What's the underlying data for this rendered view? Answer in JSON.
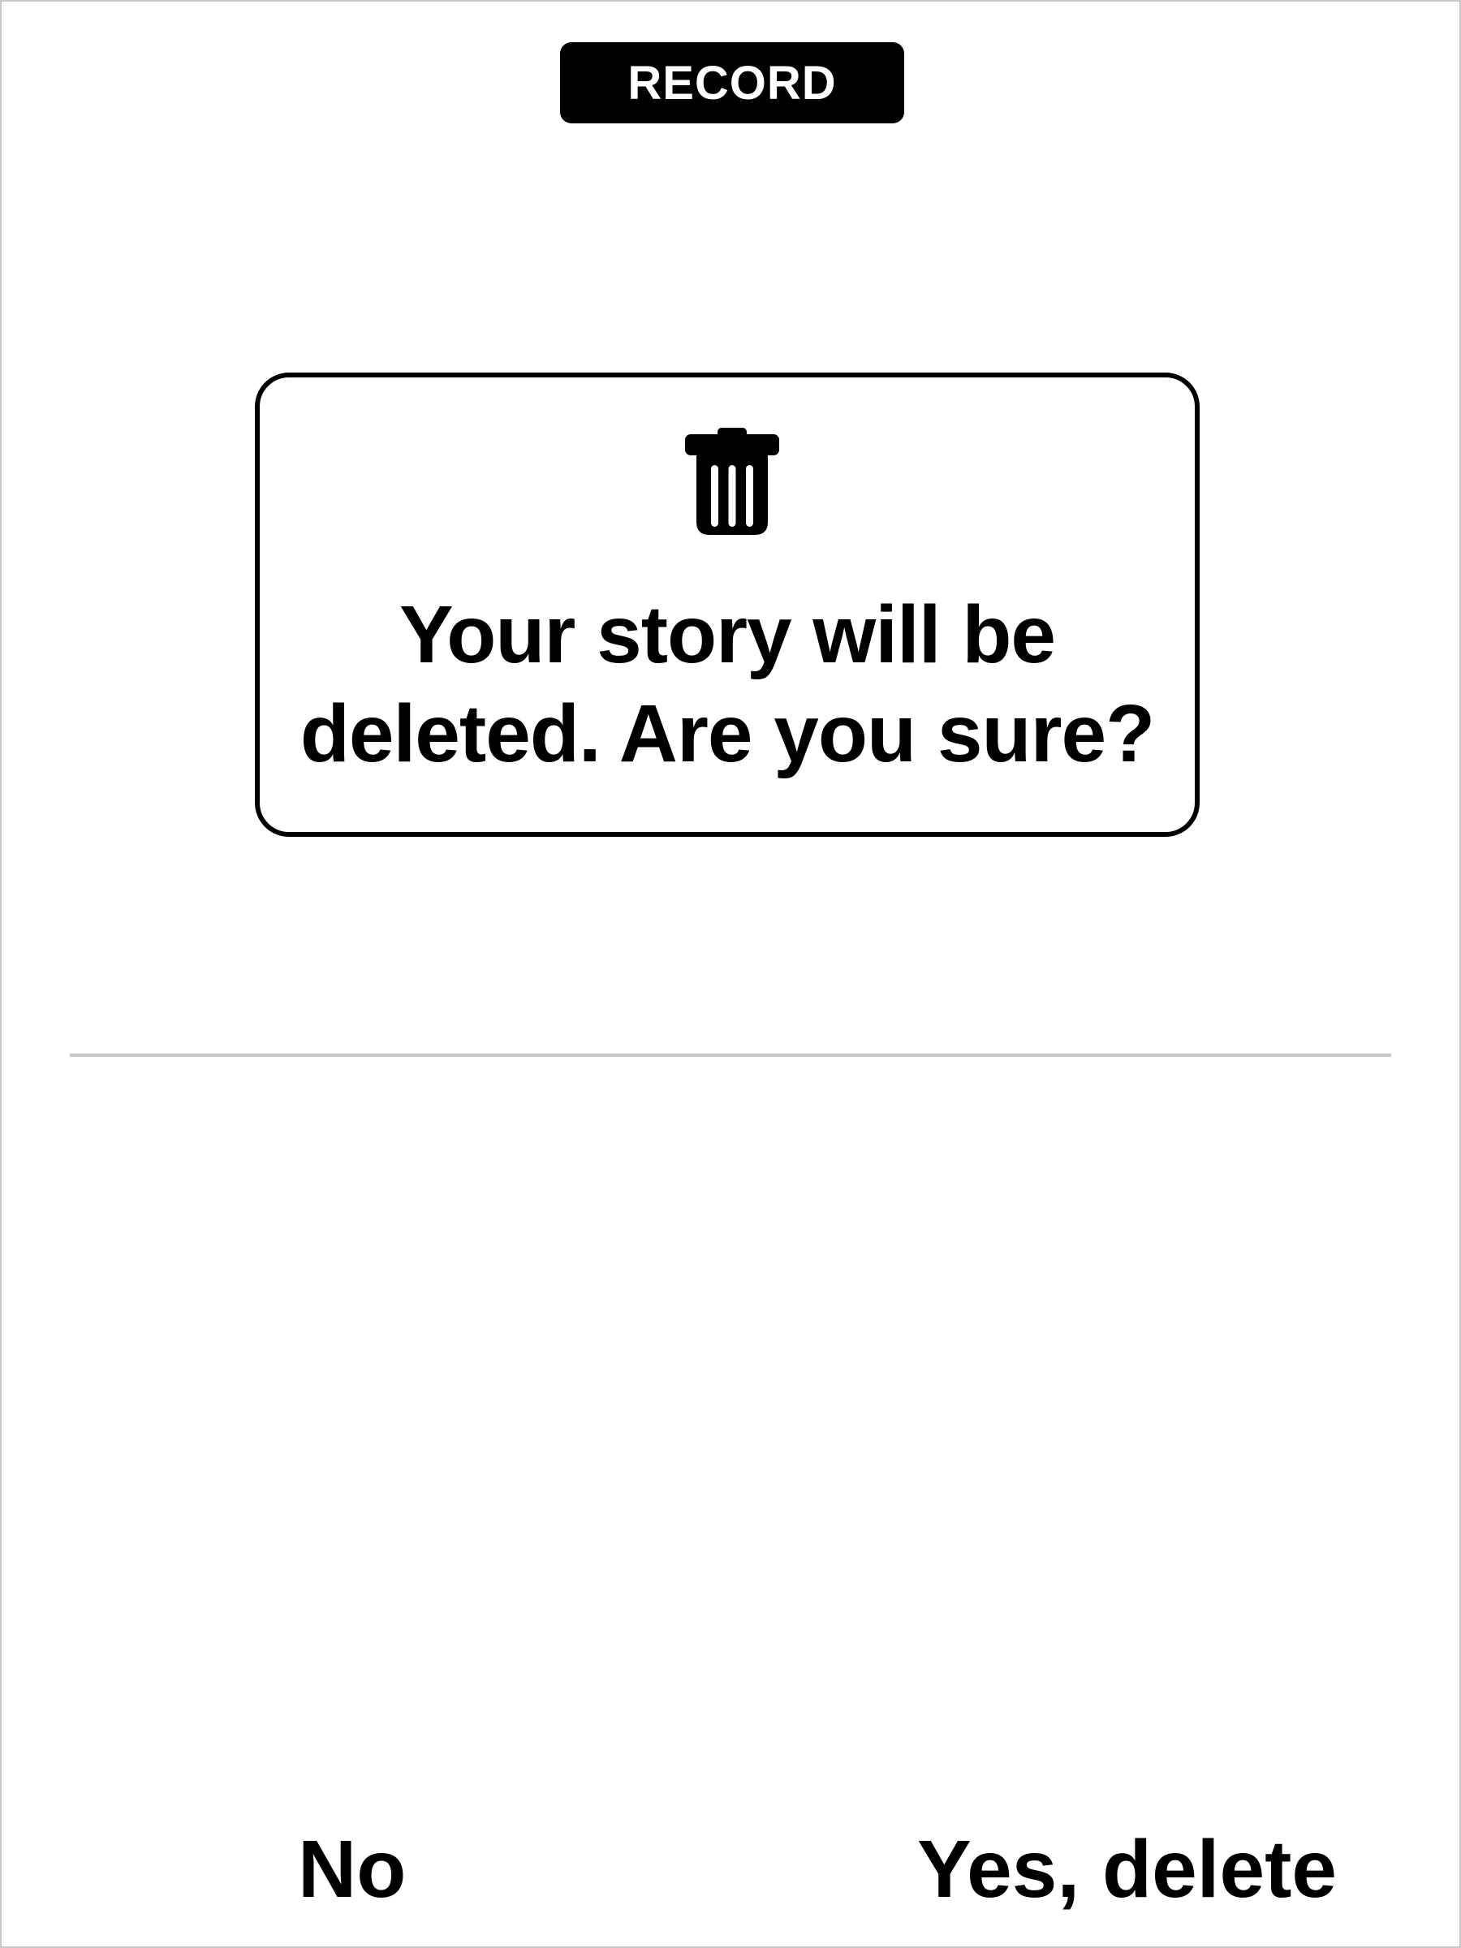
{
  "header": {
    "record_label": "RECORD"
  },
  "dialog": {
    "icon": "trash-icon",
    "message_line1": "Your story will be",
    "message_line2": "deleted. Are you sure?"
  },
  "actions": {
    "no_label": "No",
    "yes_label": "Yes, delete"
  },
  "colors": {
    "background": "#ffffff",
    "foreground": "#000000",
    "divider": "#c8c8c8"
  }
}
